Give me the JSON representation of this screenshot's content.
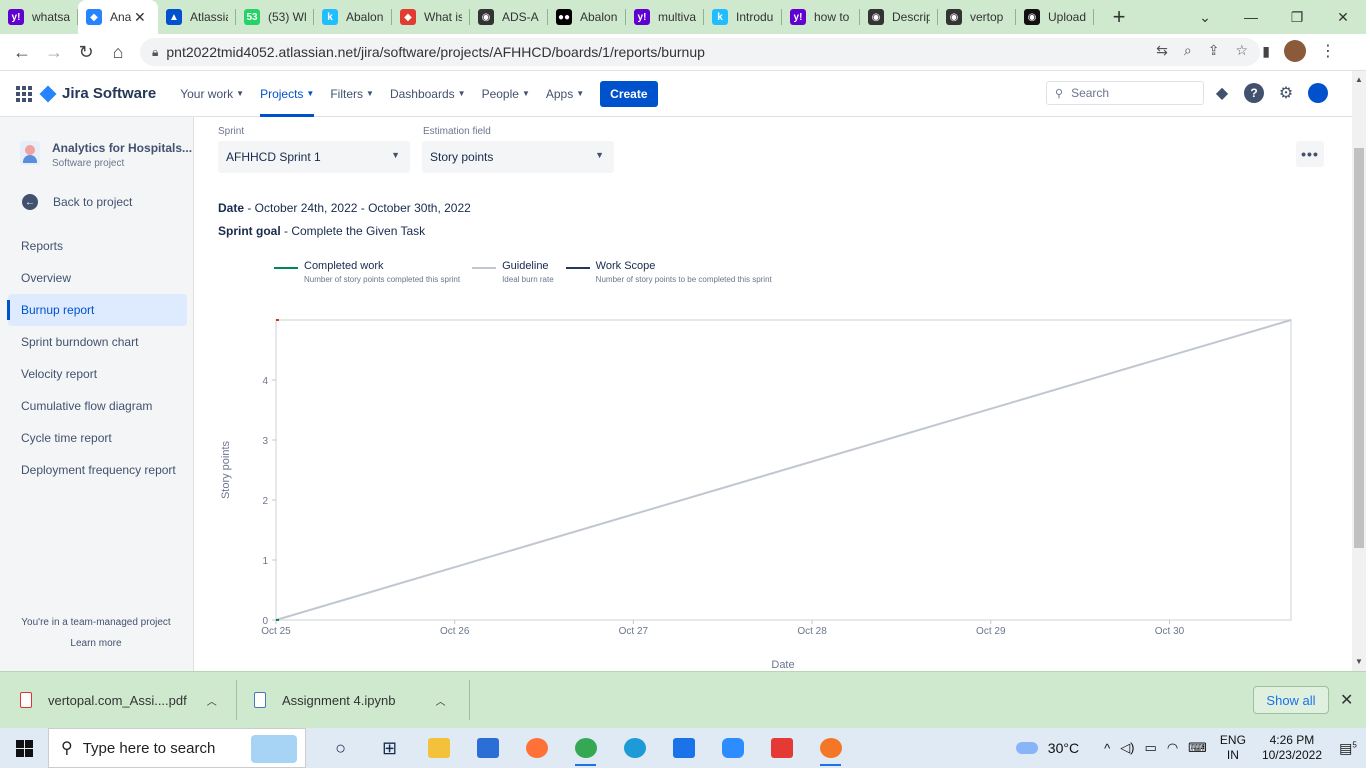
{
  "browser": {
    "tabs": [
      {
        "title": "whatsa",
        "icon": "yahoo-icon",
        "color": "#6001D2",
        "glyph": "y!"
      },
      {
        "title": "Ana",
        "icon": "jira-icon",
        "color": "#2684FF",
        "glyph": "◆",
        "active": true
      },
      {
        "title": "Atlassia",
        "icon": "atlassian-icon",
        "color": "#0052CC",
        "glyph": "▲"
      },
      {
        "title": "(53) Wl",
        "icon": "whatsapp-icon",
        "color": "#25D366",
        "glyph": "53"
      },
      {
        "title": "Abalon",
        "icon": "kaggle-icon",
        "color": "#20BEFF",
        "glyph": "k"
      },
      {
        "title": "What is",
        "icon": "gem-icon",
        "color": "#E03C31",
        "glyph": "◆"
      },
      {
        "title": "ADS-A",
        "icon": "github-circle-icon",
        "color": "#333333",
        "glyph": "◉"
      },
      {
        "title": "Abalon",
        "icon": "medium-icon",
        "color": "#000000",
        "glyph": "●●"
      },
      {
        "title": "multiva",
        "icon": "yahoo-icon",
        "color": "#6001D2",
        "glyph": "y!"
      },
      {
        "title": "Introdu",
        "icon": "kaggle-icon",
        "color": "#20BEFF",
        "glyph": "k"
      },
      {
        "title": "how to",
        "icon": "yahoo-icon",
        "color": "#6001D2",
        "glyph": "y!"
      },
      {
        "title": "Descrip",
        "icon": "globe-icon",
        "color": "#333333",
        "glyph": "◉"
      },
      {
        "title": "vertop",
        "icon": "globe-icon",
        "color": "#333333",
        "glyph": "◉"
      },
      {
        "title": "Upload",
        "icon": "github-icon",
        "color": "#111111",
        "glyph": "◉"
      }
    ],
    "url": "pnt2022tmid4052.atlassian.net/jira/software/projects/AFHHCD/boards/1/reports/burnup"
  },
  "jira": {
    "product": "Jira Software",
    "menu": [
      {
        "label": "Your work"
      },
      {
        "label": "Projects",
        "active": true
      },
      {
        "label": "Filters"
      },
      {
        "label": "Dashboards"
      },
      {
        "label": "People"
      },
      {
        "label": "Apps"
      }
    ],
    "create_label": "Create",
    "search_placeholder": "Search"
  },
  "sidebar": {
    "project_name": "Analytics for Hospitals...",
    "project_type": "Software project",
    "back_label": "Back to project",
    "section_title": "Reports",
    "items": [
      {
        "label": "Overview"
      },
      {
        "label": "Burnup report",
        "selected": true
      },
      {
        "label": "Sprint burndown chart"
      },
      {
        "label": "Velocity report"
      },
      {
        "label": "Cumulative flow diagram"
      },
      {
        "label": "Cycle time report"
      },
      {
        "label": "Deployment frequency report"
      }
    ],
    "team_note": "You're in a team-managed project",
    "learn_more": "Learn more"
  },
  "report": {
    "sprint_label": "Sprint",
    "sprint_value": "AFHHCD Sprint 1",
    "estimation_label": "Estimation field",
    "estimation_value": "Story points",
    "date_label": "Date",
    "date_value": " - October 24th, 2022 - October 30th, 2022",
    "goal_label": "Sprint goal",
    "goal_value": " - Complete the Given Task",
    "legend": [
      {
        "name": "Completed work",
        "desc": "Number of story points completed this sprint",
        "color": "#00875A"
      },
      {
        "name": "Guideline",
        "desc": "Ideal burn rate",
        "color": "#C1C7D0"
      },
      {
        "name": "Work Scope",
        "desc": "Number of story points to be completed this sprint",
        "color": "#253858"
      }
    ]
  },
  "chart_data": {
    "type": "line",
    "title": "",
    "xlabel": "Date",
    "ylabel": "Story points",
    "x_ticks": [
      "Oct 25",
      "Oct 26",
      "Oct 27",
      "Oct 28",
      "Oct 29",
      "Oct 30"
    ],
    "y_ticks": [
      0,
      1,
      2,
      3,
      4
    ],
    "ylim": [
      0,
      5
    ],
    "xlim": [
      "Oct 25",
      "Oct 30 (end of sprint)"
    ],
    "series": [
      {
        "name": "Guideline",
        "color": "#C1C7D0",
        "points": [
          {
            "x": "Oct 25",
            "y": 0
          },
          {
            "x": "Oct 30 end",
            "y": 5
          }
        ]
      },
      {
        "name": "Work Scope",
        "color": "#253858",
        "points": [
          {
            "x": "Oct 25",
            "y": 5
          }
        ]
      },
      {
        "name": "Completed work",
        "color": "#00875A",
        "points": [
          {
            "x": "Oct 25",
            "y": 0
          }
        ]
      }
    ]
  },
  "downloads": {
    "items": [
      {
        "name": "vertopal.com_Assi....pdf"
      },
      {
        "name": "Assignment 4.ipynb"
      }
    ],
    "show_all": "Show all"
  },
  "taskbar": {
    "search_placeholder": "Type here to search",
    "weather": "30°C",
    "lang1": "ENG",
    "lang2": "IN",
    "time": "4:26 PM",
    "date": "10/23/2022",
    "notifications": "5"
  }
}
